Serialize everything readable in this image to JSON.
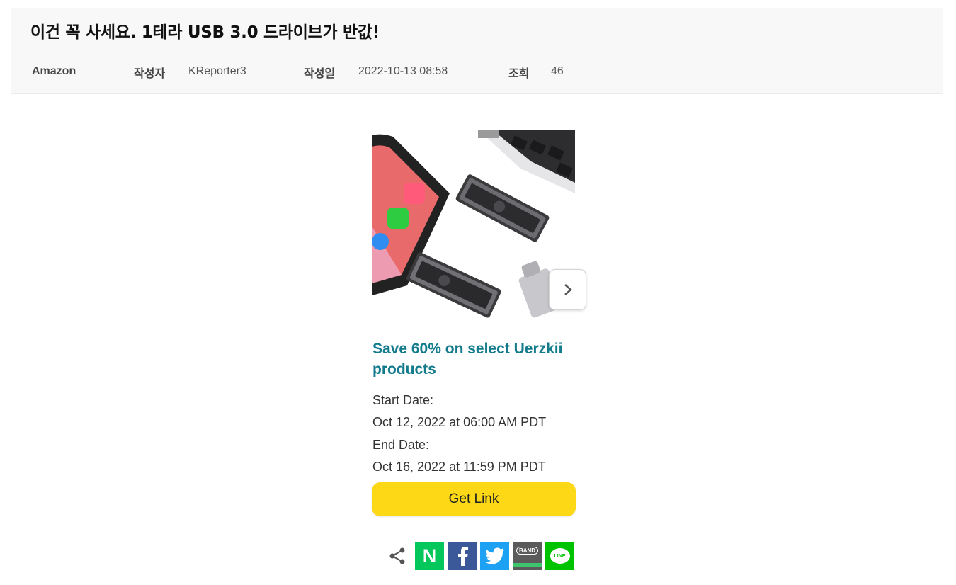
{
  "post": {
    "title": "이건 꼭 사세요. 1테라 USB 3.0 드라이브가 반값!",
    "category": "Amazon",
    "author_label": "작성자",
    "author": "KReporter3",
    "date_label": "작성일",
    "date": "2022-10-13 08:58",
    "views_label": "조회",
    "views": "46"
  },
  "deal": {
    "title": "Save 60% on select Uerzkii products",
    "start_label": "Start Date:",
    "start_value": "Oct 12, 2022 at 06:00 AM PDT",
    "end_label": "End Date:",
    "end_value": "Oct 16, 2022 at 11:59 PM PDT",
    "button_label": "Get Link"
  },
  "share": {
    "icons": [
      "share-icon",
      "naver-icon",
      "facebook-icon",
      "twitter-icon",
      "band-icon",
      "line-icon"
    ],
    "naver_letter": "N",
    "band_text": "BAND",
    "line_text": "LINE"
  },
  "colors": {
    "deal_title": "#137b8c",
    "button": "#fdd817",
    "naver": "#03c75a",
    "facebook": "#3b5998",
    "twitter": "#1da1f2",
    "band": "#5b5b5b",
    "line": "#00c300"
  }
}
